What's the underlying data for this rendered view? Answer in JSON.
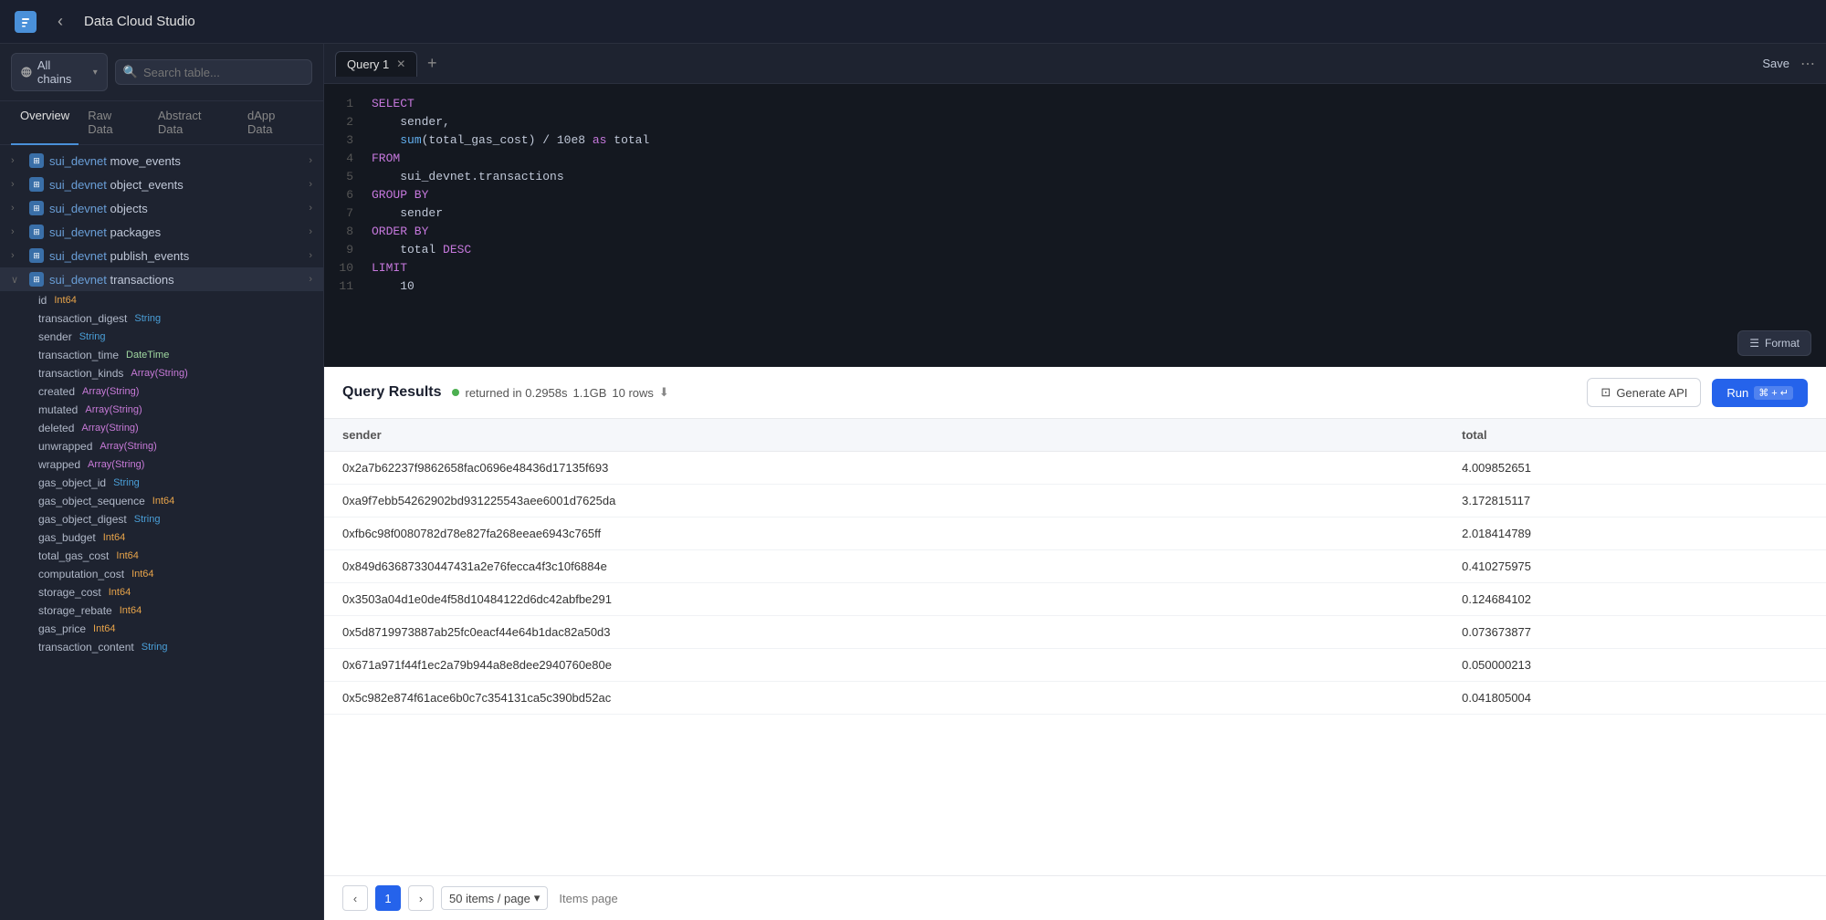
{
  "topbar": {
    "title": "Data Cloud Studio",
    "logo_symbol": "⬛"
  },
  "sidebar": {
    "chains_label": "All chains",
    "search_placeholder": "Search table...",
    "tabs": [
      "Overview",
      "Raw Data",
      "Abstract Data",
      "dApp Data"
    ],
    "active_tab": "Overview",
    "tree": [
      {
        "id": "move_events",
        "namespace": "sui_devnet",
        "name": "move_events",
        "expanded": false
      },
      {
        "id": "object_events",
        "namespace": "sui_devnet",
        "name": "object_events",
        "expanded": false
      },
      {
        "id": "objects",
        "namespace": "sui_devnet",
        "name": "objects",
        "expanded": false
      },
      {
        "id": "packages",
        "namespace": "sui_devnet",
        "name": "packages",
        "expanded": false
      },
      {
        "id": "publish_events",
        "namespace": "sui_devnet",
        "name": "publish_events",
        "expanded": false
      },
      {
        "id": "transactions",
        "namespace": "sui_devnet",
        "name": "transactions",
        "expanded": true
      }
    ],
    "fields": [
      {
        "name": "id",
        "type": "Int64",
        "type_class": "int64"
      },
      {
        "name": "transaction_digest",
        "type": "String",
        "type_class": "string"
      },
      {
        "name": "sender",
        "type": "String",
        "type_class": "string"
      },
      {
        "name": "transaction_time",
        "type": "DateTime",
        "type_class": "datetime"
      },
      {
        "name": "transaction_kinds",
        "type": "Array(String)",
        "type_class": "array"
      },
      {
        "name": "created",
        "type": "Array(String)",
        "type_class": "array"
      },
      {
        "name": "mutated",
        "type": "Array(String)",
        "type_class": "array"
      },
      {
        "name": "deleted",
        "type": "Array(String)",
        "type_class": "array"
      },
      {
        "name": "unwrapped",
        "type": "Array(String)",
        "type_class": "array"
      },
      {
        "name": "wrapped",
        "type": "Array(String)",
        "type_class": "array"
      },
      {
        "name": "gas_object_id",
        "type": "String",
        "type_class": "string"
      },
      {
        "name": "gas_object_sequence",
        "type": "Int64",
        "type_class": "int64"
      },
      {
        "name": "gas_object_digest",
        "type": "String",
        "type_class": "string"
      },
      {
        "name": "gas_budget",
        "type": "Int64",
        "type_class": "int64"
      },
      {
        "name": "total_gas_cost",
        "type": "Int64",
        "type_class": "int64"
      },
      {
        "name": "computation_cost",
        "type": "Int64",
        "type_class": "int64"
      },
      {
        "name": "storage_cost",
        "type": "Int64",
        "type_class": "int64"
      },
      {
        "name": "storage_rebate",
        "type": "Int64",
        "type_class": "int64"
      },
      {
        "name": "gas_price",
        "type": "Int64",
        "type_class": "int64"
      },
      {
        "name": "transaction_content",
        "type": "String",
        "type_class": "string"
      }
    ]
  },
  "query_editor": {
    "tabs": [
      "Query 1"
    ],
    "active_tab": "Query 1",
    "save_label": "Save",
    "format_label": "Format",
    "lines": [
      {
        "num": 1,
        "code": "<kw>SELECT</kw>"
      },
      {
        "num": 2,
        "code": "    sender,"
      },
      {
        "num": 3,
        "code": "    <fn>sum</fn>(total_gas_cost) / 10e8 <kw>as</kw> total"
      },
      {
        "num": 4,
        "code": "<kw>FROM</kw>"
      },
      {
        "num": 5,
        "code": "    sui_devnet.transactions"
      },
      {
        "num": 6,
        "code": "<kw>GROUP BY</kw>"
      },
      {
        "num": 7,
        "code": "    sender"
      },
      {
        "num": 8,
        "code": "<kw>ORDER BY</kw>"
      },
      {
        "num": 9,
        "code": "    total <kw>DESC</kw>"
      },
      {
        "num": 10,
        "code": "<kw>LIMIT</kw>"
      },
      {
        "num": 11,
        "code": "    10"
      }
    ]
  },
  "results": {
    "title": "Query Results",
    "status": "returned in 0.2958s",
    "size": "1.1GB",
    "rows": "10 rows",
    "generate_api_label": "Generate API",
    "run_label": "Run",
    "run_shortcut": "⌘ + ↵",
    "columns": [
      "sender",
      "total"
    ],
    "rows_data": [
      {
        "sender": "0x2a7b62237f9862658fac0696e48436d17135f693",
        "total": "4.009852651"
      },
      {
        "sender": "0xa9f7ebb54262902bd931225543aee6001d7625da",
        "total": "3.172815117"
      },
      {
        "sender": "0xfb6c98f0080782d78e827fa268eeae6943c765ff",
        "total": "2.018414789"
      },
      {
        "sender": "0x849d63687330447431a2e76fecca4f3c10f6884e",
        "total": "0.410275975"
      },
      {
        "sender": "0x3503a04d1e0de4f58d10484122d6dc42abfbe291",
        "total": "0.124684102"
      },
      {
        "sender": "0x5d8719973887ab25fc0eacf44e64b1dac82a50d3",
        "total": "0.073673877"
      },
      {
        "sender": "0x671a971f44f1ec2a79b944a8e8dee2940760e80e",
        "total": "0.050000213"
      },
      {
        "sender": "0x5c982e874f61ace6b0c7c354131ca5c390bd52ac",
        "total": "0.041805004"
      }
    ],
    "pagination": {
      "current_page": 1,
      "items_per_page": "50 items / page",
      "items_page_label": "Items page"
    }
  }
}
